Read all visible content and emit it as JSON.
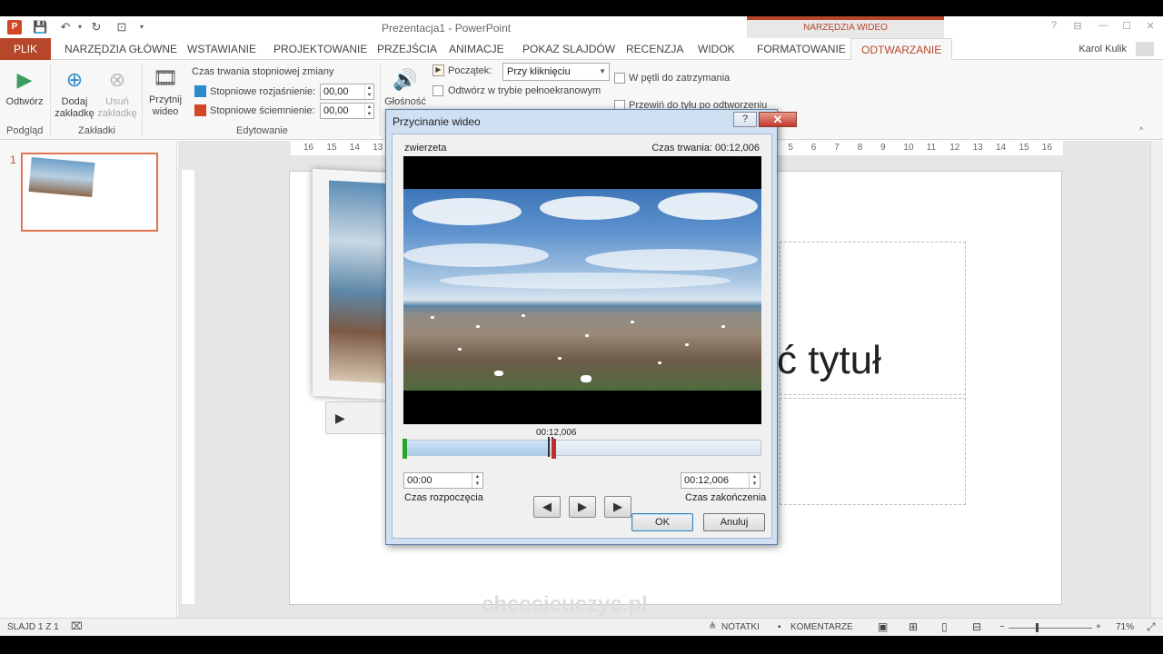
{
  "app": {
    "title": "Prezentacja1 - PowerPoint",
    "contextual_group": "NARZĘDZIA WIDEO",
    "user": "Karol Kulik"
  },
  "tabs": [
    {
      "label": "PLIK"
    },
    {
      "label": "NARZĘDZIA GŁÓWNE"
    },
    {
      "label": "WSTAWIANIE"
    },
    {
      "label": "PROJEKTOWANIE"
    },
    {
      "label": "PRZEJŚCIA"
    },
    {
      "label": "ANIMACJE"
    },
    {
      "label": "POKAZ SLAJDÓW"
    },
    {
      "label": "RECENZJA"
    },
    {
      "label": "WIDOK"
    },
    {
      "label": "FORMATOWANIE"
    },
    {
      "label": "ODTWARZANIE"
    }
  ],
  "ribbon": {
    "play_label": "Odtwórz",
    "preview_group": "Podgląd",
    "add_bookmark": [
      "Dodaj",
      "zakładkę"
    ],
    "remove_bookmark": [
      "Usuń",
      "zakładkę"
    ],
    "bookmarks_group": "Zakładki",
    "trim_video": [
      "Przytnij",
      "wideo"
    ],
    "fade_duration_label": "Czas trwania stopniowej zmiany",
    "fade_in_label": "Stopniowe rozjaśnienie:",
    "fade_in_value": "00,00",
    "fade_out_label": "Stopniowe ściemnienie:",
    "fade_out_value": "00,00",
    "editing_group": "Edytowanie",
    "volume_label": "Głośność",
    "start_label": "Początek:",
    "start_value": "Przy kliknięciu",
    "fullscreen_label": "Odtwórz w trybie pełnoekranowym",
    "loop_label": "W pętli do zatrzymania",
    "rewind_label": "Przewiń do tyłu po odtworzeniu"
  },
  "thumbnails": [
    {
      "number": "1"
    }
  ],
  "slide": {
    "title_fragment": "ć tytuł",
    "watermark": "chcesieuczyc.pl"
  },
  "dialog": {
    "title": "Przycinanie wideo",
    "help": "?",
    "close": "✕",
    "video_name": "zwierzeta",
    "duration": "Czas trwania: 00:12,006",
    "current_time": "00:12,006",
    "start_time": "00:00",
    "start_label": "Czas rozpoczęcia",
    "end_time": "00:12,006",
    "end_label": "Czas zakończenia",
    "ok": "OK",
    "cancel": "Anuluj",
    "playhead_position": 0.41
  },
  "status": {
    "slide_info": "SLAJD 1 Z 1",
    "notes": "NOTATKI",
    "comments": "KOMENTARZE",
    "zoom": "71%"
  },
  "colors": {
    "accent": "#b7472a",
    "ok_border": "#3c7fb1"
  }
}
